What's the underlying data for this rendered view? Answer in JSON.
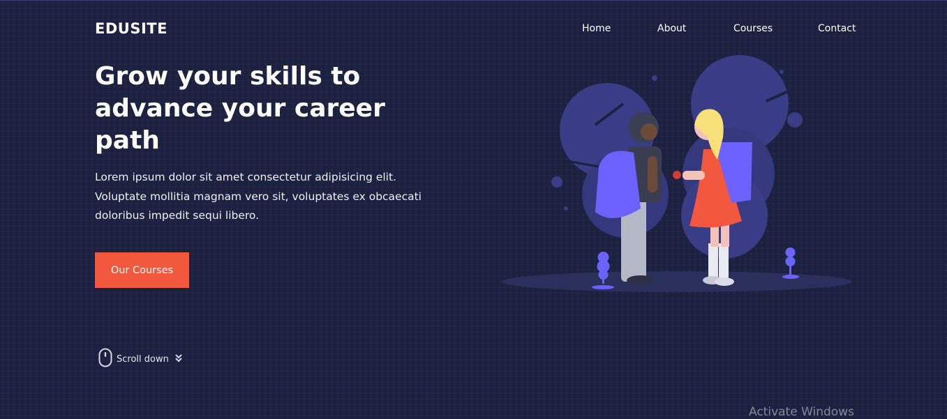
{
  "brand": {
    "logo": "EDUSITE"
  },
  "nav": {
    "items": [
      {
        "label": "Home"
      },
      {
        "label": "About"
      },
      {
        "label": "Courses"
      },
      {
        "label": "Contact"
      }
    ]
  },
  "hero": {
    "title": "Grow your skills to advance your career path",
    "description": "Lorem ipsum dolor sit amet consectetur adipisicing elit. Voluptate mollitia magnam vero sit, voluptates ex obcaecati doloribus impedit sequi libero.",
    "cta_label": "Our Courses"
  },
  "scroll": {
    "label": "Scroll down"
  },
  "os_watermark": {
    "text": "Activate Windows"
  },
  "colors": {
    "background": "#1c2140",
    "accent": "#f2583e",
    "illustration_purple": "#6c63ff"
  }
}
